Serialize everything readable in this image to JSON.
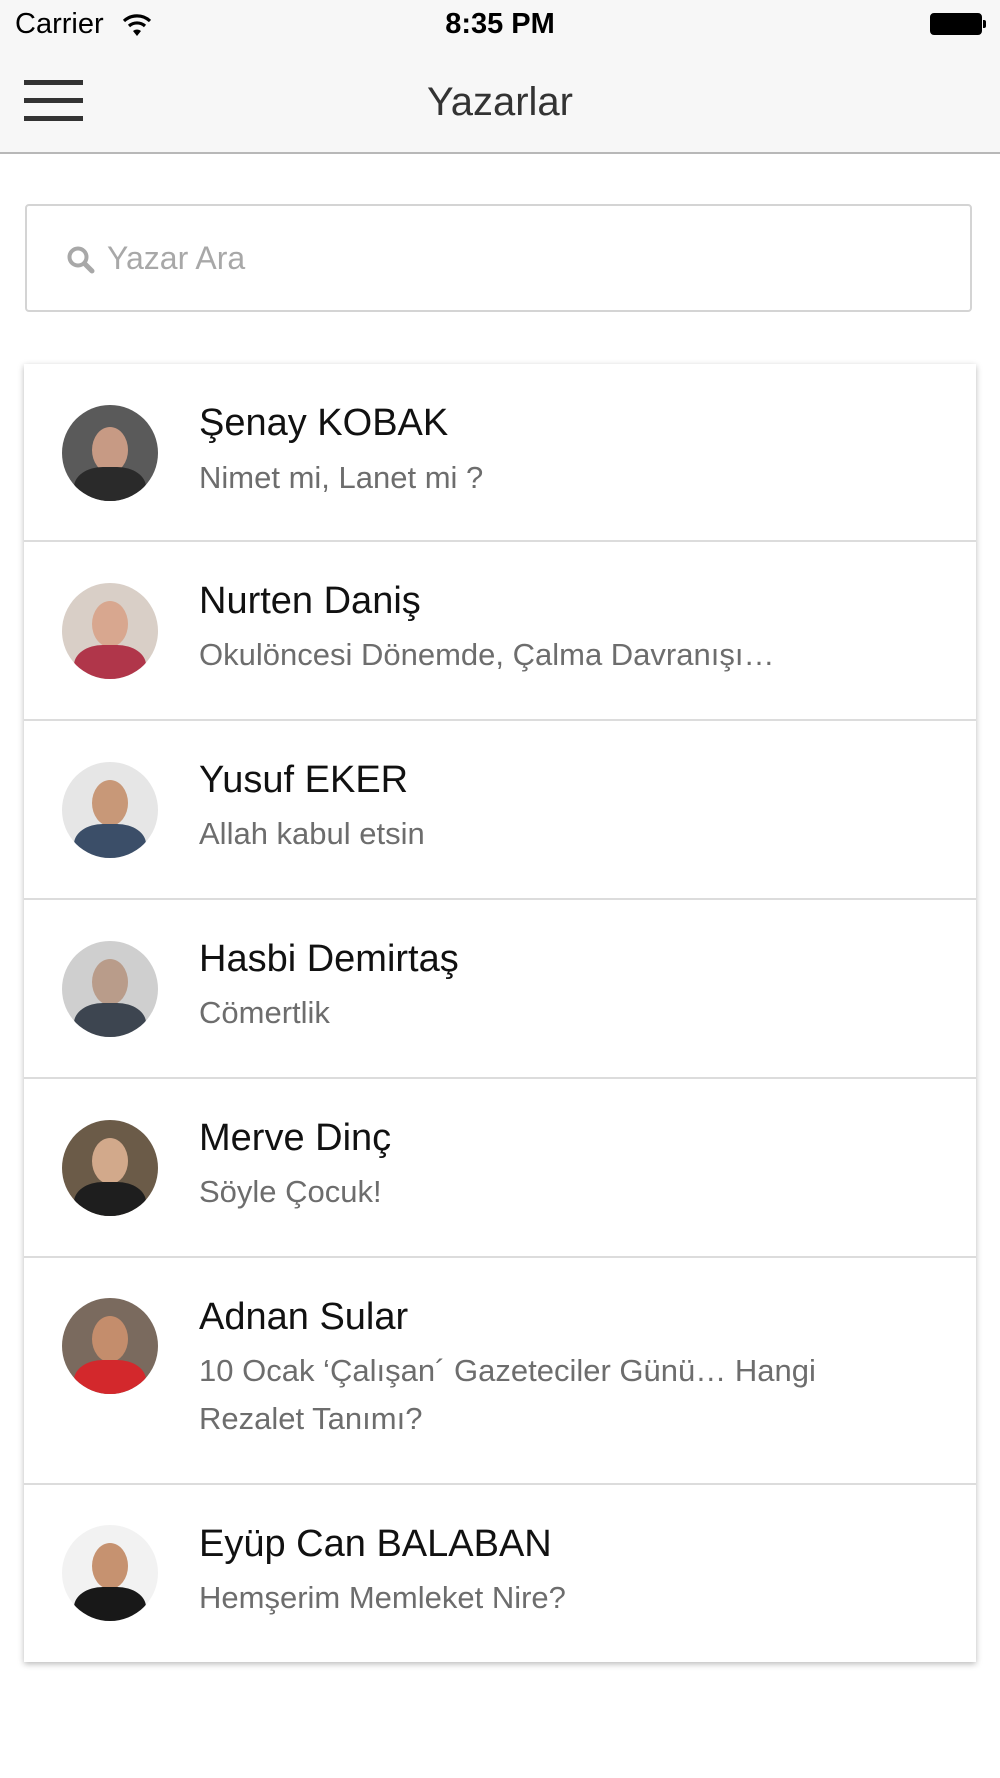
{
  "status_bar": {
    "carrier": "Carrier",
    "wifi_icon": "wifi-icon",
    "time": "8:35 PM",
    "battery_icon": "battery-icon"
  },
  "nav": {
    "menu_icon": "hamburger-menu-icon",
    "title": "Yazarlar"
  },
  "search": {
    "icon": "search-icon",
    "placeholder": "Yazar Ara",
    "value": ""
  },
  "authors": [
    {
      "name": "Şenay KOBAK",
      "title": "Nimet mi, Lanet mi ?"
    },
    {
      "name": "Nurten Daniş",
      "title": "Okulöncesi Dönemde, Çalma Davranışı…"
    },
    {
      "name": "Yusuf EKER",
      "title": "Allah kabul etsin"
    },
    {
      "name": "Hasbi Demirtaş",
      "title": "Cömertlik"
    },
    {
      "name": "Merve Dinç",
      "title": "Söyle Çocuk!"
    },
    {
      "name": "Adnan Sular",
      "title": "10 Ocak ‘Çalışan´ Gazeteciler Günü… Hangi Rezalet Tanımı?"
    },
    {
      "name": "Eyüp Can BALABAN",
      "title": "Hemşerim Memleket Nire?"
    }
  ]
}
